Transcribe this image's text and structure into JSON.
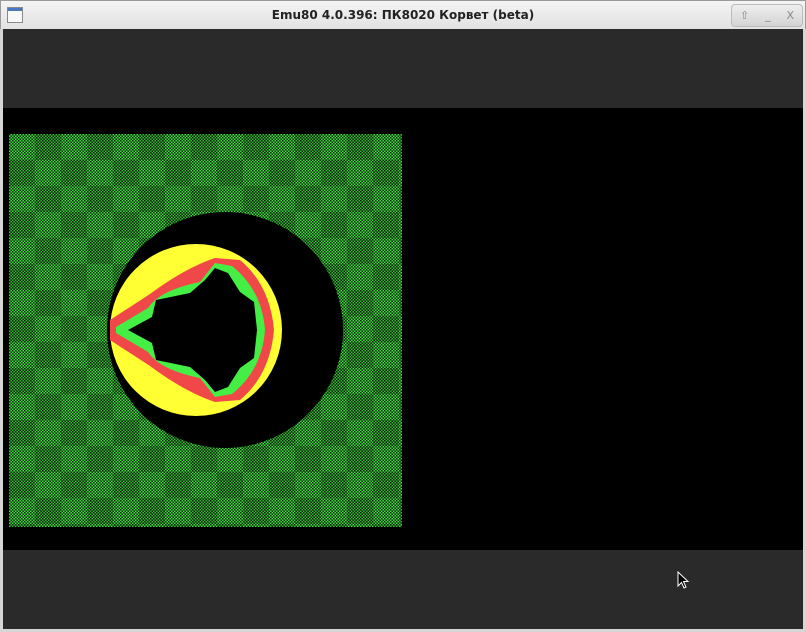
{
  "window": {
    "title": "Emu80 4.0.396: ПК8020 Корвет (beta)",
    "buttons": {
      "maximize": "⇧",
      "minimize": "_",
      "close": "X"
    }
  },
  "colors": {
    "green": "#44ee44",
    "yellow": "#ffff33",
    "red": "#f04848",
    "black": "#000000"
  }
}
